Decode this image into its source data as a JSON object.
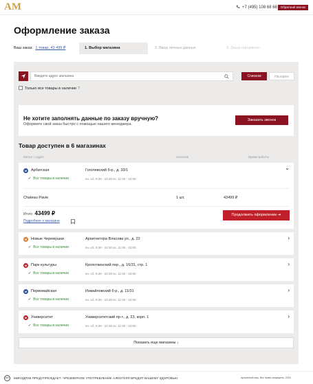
{
  "header": {
    "logo_text": "AM",
    "phone": "+7 (495) 108 68 68",
    "callback_label": "Обратный звонок"
  },
  "page": {
    "title": "Оформление заказа"
  },
  "order": {
    "label": "Ваш заказ:",
    "link": "1 товар, 43 499 ₽"
  },
  "steps": [
    {
      "label": "1. Выбор магазина",
      "active": true
    },
    {
      "label": "2. Ввод личных данных",
      "active": false
    },
    {
      "label": "3. Заказ оформлен",
      "active": false
    }
  ],
  "search": {
    "placeholder": "Введите адрес магазина",
    "view_list": "Списком",
    "view_map": "На карте",
    "only_all_label": "Только все товары в наличии",
    "help": "?"
  },
  "manager": {
    "title": "Не хотите заполнять данные по заказу вручную?",
    "subtitle": "Оформите свой заказ быстро с помощью нашего менеджера.",
    "button": "Заказать звонок"
  },
  "availability": {
    "title": "Товар доступен в 6 магазинах",
    "col_metro": "Метро / Адрес",
    "col_stock": "Наличие",
    "col_hours": "Время работы"
  },
  "stores": [
    {
      "metro": "Арбатская",
      "line": "М",
      "color": "#2b4fa0",
      "status": "Все товары в наличии",
      "address": "Гоголевский б-р., д. 33/1",
      "hours": "пн.-сб. 9:30 - 22:30 вс. 11:00 - 22:00",
      "expanded": true
    },
    {
      "metro": "Новые Черемушки",
      "line": "М",
      "color": "#e07b2a",
      "status": "Все товары в наличии",
      "address": "Архитектора Власова ул., д. 22",
      "hours": "пн.-сб. 9:30 - 22:30 вс. 11:00 - 22:00",
      "expanded": false
    },
    {
      "metro": "Парк культуры",
      "line": "М",
      "color": "#c0202a",
      "status": "Все товары в наличии",
      "address": "Кропоткинский пер., д. 16/31, стр. 1",
      "hours": "пн.-сб. 9:30 - 22:30 вс. 11:00 - 22:00",
      "expanded": false
    },
    {
      "metro": "Первомайская",
      "line": "М",
      "color": "#2b4fa0",
      "status": "Все товары в наличии",
      "address": "Измайловский б-р., д. 11/31",
      "hours": "пн.-сб. 9:30 - 22:30 вс. 11:00 - 22:00",
      "expanded": false
    },
    {
      "metro": "Университет",
      "line": "М",
      "color": "#c0202a",
      "status": "Все товары в наличии",
      "address": "Университетский пр-т., д. 23, корп. 1",
      "hours": "пн.-сб. 9:30 - 22:30 вс. 11:00 - 22:00",
      "expanded": false
    }
  ],
  "product": {
    "name": "Chateau Pavie",
    "qty": "1 шт.",
    "price": "43499 ₽"
  },
  "total": {
    "label": "Итого",
    "value": "43499 ₽",
    "details": "Подробнее о магазине",
    "proceed": "Продолжить оформление"
  },
  "more": {
    "label": "Показать еще магазины"
  },
  "footer": {
    "age": "18+",
    "warning": "МИНЗДРАВ ПРЕДУПРЕЖДАЕТ: ЧРЕЗМЕРНОЕ УПОТРЕБЛЕНИЕ АЛКОГОЛЯ ВРЕДИТ ВАШЕМУ ЗДОРОВЬЮ",
    "copyright": "Ароматный мир. Все права защищены, 2018"
  },
  "colors": {
    "brand": "#8b1220",
    "accent": "#c0202a",
    "logo": "#c9a24a",
    "link": "#3a5fa8",
    "in_stock": "#3a8a3a"
  }
}
